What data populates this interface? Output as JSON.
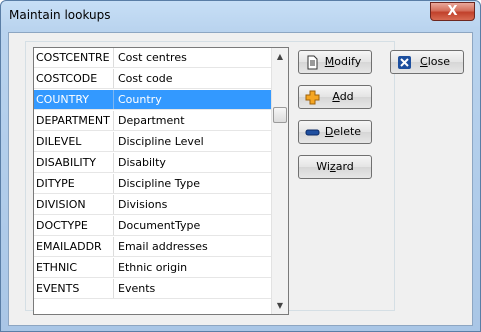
{
  "window": {
    "title": "Maintain lookups",
    "close_glyph": "X"
  },
  "list": {
    "selected_index": 2,
    "rows": [
      {
        "code": "COSTCENTRE",
        "description": "Cost centres"
      },
      {
        "code": "COSTCODE",
        "description": "Cost code"
      },
      {
        "code": "COUNTRY",
        "description": "Country"
      },
      {
        "code": "DEPARTMENT",
        "description": "Department"
      },
      {
        "code": "DILEVEL",
        "description": "Discipline Level"
      },
      {
        "code": "DISABILITY",
        "description": "Disabilty"
      },
      {
        "code": "DITYPE",
        "description": "Discipline Type"
      },
      {
        "code": "DIVISION",
        "description": "Divisions"
      },
      {
        "code": "DOCTYPE",
        "description": "DocumentType"
      },
      {
        "code": "EMAILADDR",
        "description": "Email addresses"
      },
      {
        "code": "ETHNIC",
        "description": "Ethnic origin"
      },
      {
        "code": "EVENTS",
        "description": "Events"
      }
    ]
  },
  "buttons": {
    "modify": {
      "pre": "",
      "accel": "M",
      "post": "odify",
      "icon": "document-edit-icon"
    },
    "add": {
      "pre": "",
      "accel": "A",
      "post": "dd",
      "icon": "plus-icon"
    },
    "delete": {
      "pre": "",
      "accel": "D",
      "post": "elete",
      "icon": "minus-icon"
    },
    "wizard": {
      "pre": "Wi",
      "accel": "z",
      "post": "ard"
    },
    "close": {
      "pre": "",
      "accel": "C",
      "post": "lose",
      "icon": "close-x-icon"
    }
  },
  "colors": {
    "selection": "#3399ff",
    "title_close": "#c1412b"
  }
}
